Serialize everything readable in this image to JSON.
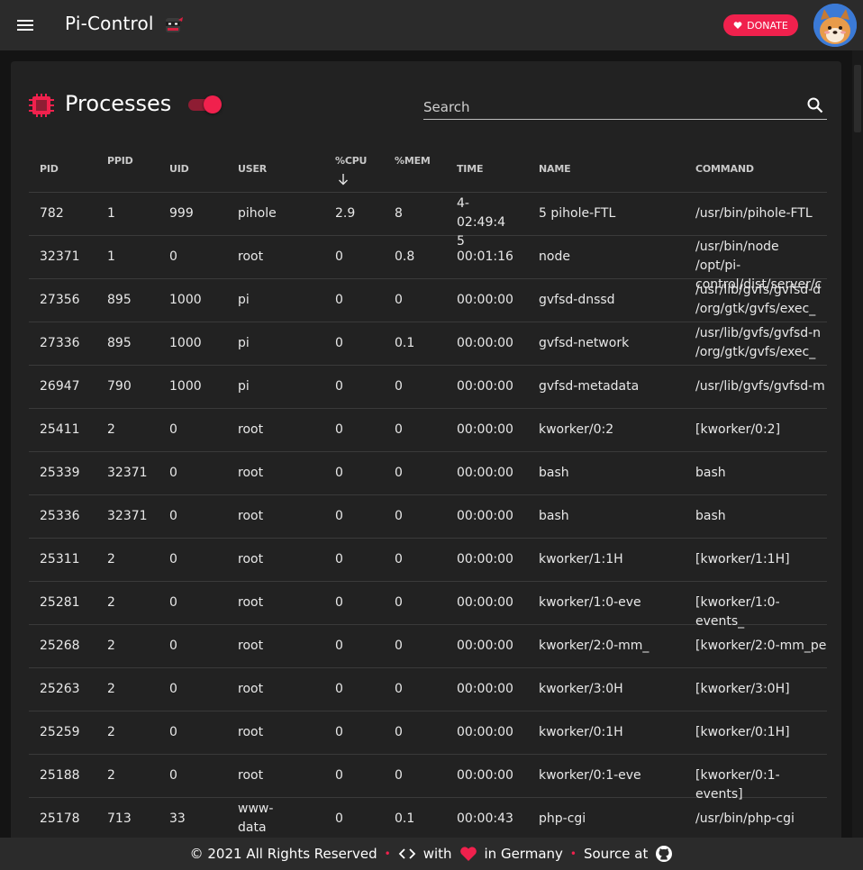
{
  "app": {
    "title": "Pi-Control",
    "donate_label": "DONATE",
    "accent": "#f0214d",
    "icons": {
      "menu": "hamburger-menu-icon",
      "logo": "ninja-icon",
      "donate": "heart-icon",
      "avatar": "dog-avatar"
    }
  },
  "page": {
    "title": "Processes",
    "toggle_on": true,
    "search_placeholder": "Search",
    "icons": {
      "section": "chip-icon",
      "search": "search-icon"
    }
  },
  "table": {
    "columns": [
      "PID",
      "PPID",
      "UID",
      "USER",
      "%CPU",
      "%MEM",
      "TIME",
      "NAME",
      "COMMAND"
    ],
    "sort_column": "%CPU",
    "sort_direction": "desc",
    "rows": [
      {
        "pid": "782",
        "ppid": "1",
        "uid": "999",
        "user": "pihole",
        "cpu": "2.9",
        "mem": "8",
        "time": "4-02:49:45",
        "name": "5 pihole-FTL",
        "command": "/usr/bin/pihole-FTL"
      },
      {
        "pid": "32371",
        "ppid": "1",
        "uid": "0",
        "user": "root",
        "cpu": "0",
        "mem": "0.8",
        "time": "00:01:16",
        "name": "node",
        "command": "/usr/bin/node /opt/pi-control/dist/server/c"
      },
      {
        "pid": "27356",
        "ppid": "895",
        "uid": "1000",
        "user": "pi",
        "cpu": "0",
        "mem": "0",
        "time": "00:00:00",
        "name": "gvfsd-dnssd",
        "command": "/usr/lib/gvfs/gvfsd-d /org/gtk/gvfs/exec_"
      },
      {
        "pid": "27336",
        "ppid": "895",
        "uid": "1000",
        "user": "pi",
        "cpu": "0",
        "mem": "0.1",
        "time": "00:00:00",
        "name": "gvfsd-network",
        "command": "/usr/lib/gvfs/gvfsd-n /org/gtk/gvfs/exec_"
      },
      {
        "pid": "26947",
        "ppid": "790",
        "uid": "1000",
        "user": "pi",
        "cpu": "0",
        "mem": "0",
        "time": "00:00:00",
        "name": "gvfsd-metadata",
        "command": "/usr/lib/gvfs/gvfsd-m"
      },
      {
        "pid": "25411",
        "ppid": "2",
        "uid": "0",
        "user": "root",
        "cpu": "0",
        "mem": "0",
        "time": "00:00:00",
        "name": "kworker/0:2",
        "command": "[kworker/0:2]"
      },
      {
        "pid": "25339",
        "ppid": "32371",
        "uid": "0",
        "user": "root",
        "cpu": "0",
        "mem": "0",
        "time": "00:00:00",
        "name": "bash",
        "command": "bash"
      },
      {
        "pid": "25336",
        "ppid": "32371",
        "uid": "0",
        "user": "root",
        "cpu": "0",
        "mem": "0",
        "time": "00:00:00",
        "name": "bash",
        "command": "bash"
      },
      {
        "pid": "25311",
        "ppid": "2",
        "uid": "0",
        "user": "root",
        "cpu": "0",
        "mem": "0",
        "time": "00:00:00",
        "name": "kworker/1:1H",
        "command": "[kworker/1:1H]"
      },
      {
        "pid": "25281",
        "ppid": "2",
        "uid": "0",
        "user": "root",
        "cpu": "0",
        "mem": "0",
        "time": "00:00:00",
        "name": "kworker/1:0-eve",
        "command": "[kworker/1:0-events_"
      },
      {
        "pid": "25268",
        "ppid": "2",
        "uid": "0",
        "user": "root",
        "cpu": "0",
        "mem": "0",
        "time": "00:00:00",
        "name": "kworker/2:0-mm_",
        "command": "[kworker/2:0-mm_pe"
      },
      {
        "pid": "25263",
        "ppid": "2",
        "uid": "0",
        "user": "root",
        "cpu": "0",
        "mem": "0",
        "time": "00:00:00",
        "name": "kworker/3:0H",
        "command": "[kworker/3:0H]"
      },
      {
        "pid": "25259",
        "ppid": "2",
        "uid": "0",
        "user": "root",
        "cpu": "0",
        "mem": "0",
        "time": "00:00:00",
        "name": "kworker/0:1H",
        "command": "[kworker/0:1H]"
      },
      {
        "pid": "25188",
        "ppid": "2",
        "uid": "0",
        "user": "root",
        "cpu": "0",
        "mem": "0",
        "time": "00:00:00",
        "name": "kworker/0:1-eve",
        "command": "[kworker/0:1-events]"
      },
      {
        "pid": "25178",
        "ppid": "713",
        "uid": "33",
        "user": "www-data",
        "cpu": "0",
        "mem": "0.1",
        "time": "00:00:43",
        "name": "php-cgi",
        "command": "/usr/bin/php-cgi"
      }
    ]
  },
  "footer": {
    "copyright": "© 2021 All Rights Reserved",
    "with": "with",
    "country": "in Germany",
    "source": "Source at",
    "icons": {
      "code": "code-brackets-icon",
      "love": "heart-icon",
      "source": "github-icon"
    }
  }
}
